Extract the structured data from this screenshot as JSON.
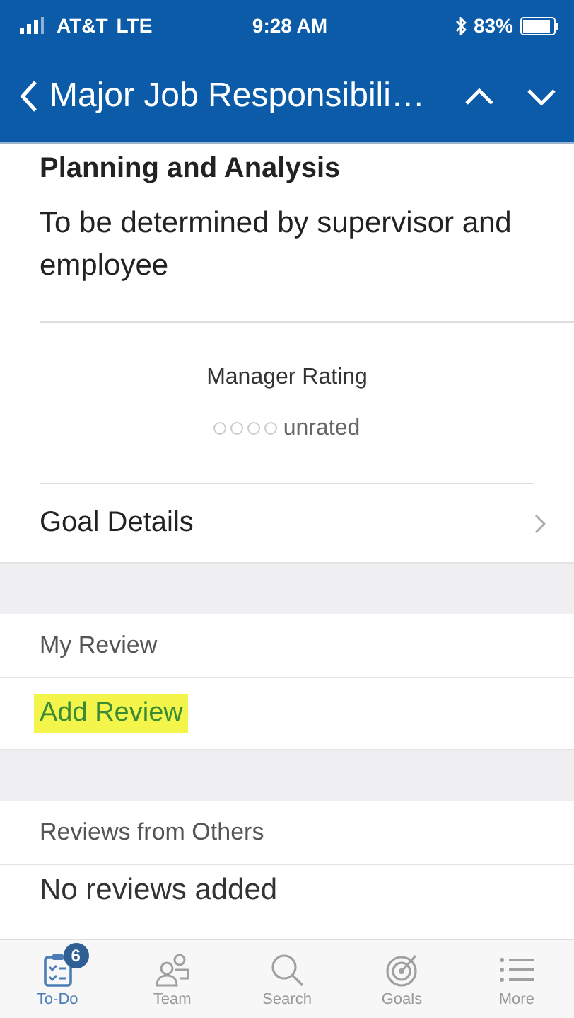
{
  "status_bar": {
    "carrier": "AT&T",
    "network": "LTE",
    "time": "9:28 AM",
    "battery": "83%"
  },
  "nav_bar": {
    "title": "Major Job Responsibili…"
  },
  "section": {
    "title": "Planning and Analysis",
    "description": "To be determined by supervisor and employee"
  },
  "rating": {
    "label": "Manager Rating",
    "stars": 0,
    "value": "unrated"
  },
  "rows": [
    {
      "kind": "link",
      "label": "Goal Details"
    },
    {
      "kind": "gap"
    },
    {
      "kind": "header",
      "label": "My Review"
    },
    {
      "kind": "action",
      "label": "Add Review",
      "highlighted": true
    },
    {
      "kind": "gap"
    },
    {
      "kind": "header",
      "label": "Reviews from Others"
    },
    {
      "kind": "text",
      "label": "No reviews added"
    }
  ],
  "tab_bar": [
    {
      "label": "To-Do",
      "badge": "6",
      "selected": true
    },
    {
      "label": "Team",
      "selected": false
    },
    {
      "label": "Search",
      "selected": false
    },
    {
      "label": "Goals",
      "selected": false
    },
    {
      "label": "More",
      "selected": false
    }
  ]
}
